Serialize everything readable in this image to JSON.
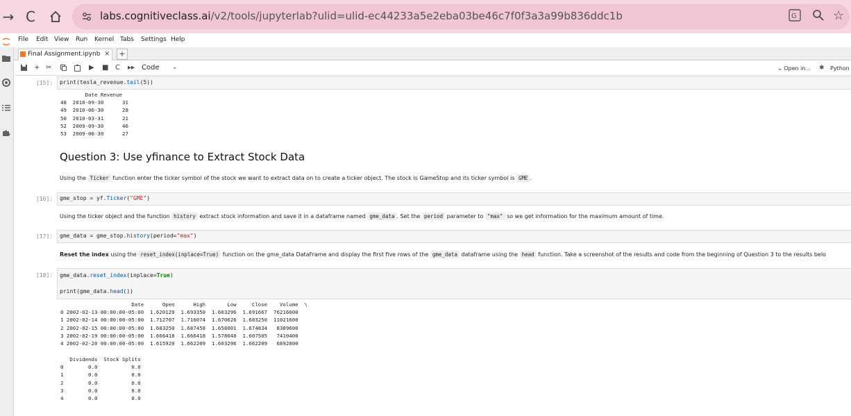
{
  "browser": {
    "url_host": "labs.cognitiveclass.ai",
    "url_path": "/v2/tools/jupyterlab?ulid=ulid-ec44233a5e2eba03be46c7f0f3a3a99b836ddc1b"
  },
  "menu": [
    "File",
    "Edit",
    "View",
    "Run",
    "Kernel",
    "Tabs",
    "Settings",
    "Help"
  ],
  "tab": {
    "title": "Final Assignment.ipynb",
    "close": "×",
    "add": "+"
  },
  "toolbar": {
    "cell_type": "Code",
    "open_in": "Open in...",
    "kernel": "Python"
  },
  "cells": {
    "c15": {
      "prompt": "[15]:",
      "code_obj": "print(tesla_revenue.",
      "code_fn": "tail",
      "code_end": "(5))",
      "output": "        Date Revenue\n48  2010-09-30      31\n49  2010-06-30      28\n50  2010-03-31      21\n52  2009-09-30      46\n53  2009-06-30      27"
    },
    "q3_heading": "Question 3: Use yfinance to Extract Stock Data",
    "md1": {
      "a": "Using the",
      "code1": "Ticker",
      "b": "function enter the ticker symbol of the stock we want to extract data on to create a ticker object. The stock is GameStop and its ticker symbol is",
      "code2": "GME",
      "c": "."
    },
    "c16": {
      "prompt": "[16]:",
      "code_a": "gme_stop = yf.",
      "code_fn": "Ticker",
      "code_b": "(",
      "code_str": "\"GME\"",
      "code_c": ")"
    },
    "md2": {
      "a": "Using the ticker object and the function",
      "code1": "history",
      "b": "extract stock information and save it in a dataframe named",
      "code2": "gme_data",
      "c": ". Set the",
      "code3": "period",
      "d": "parameter to",
      "code4": "\"max\"",
      "e": "so we get information for the maximum amount of time."
    },
    "c17": {
      "prompt": "[17]:",
      "code_a": "gme_data = gme_stop.",
      "code_fn": "history",
      "code_b": "(period=",
      "code_str": "\"max\"",
      "code_c": ")"
    },
    "md3": {
      "bold": "Reset the index",
      "a": "using the",
      "code1": "reset_index(inplace=True)",
      "b": "function on the gme_data DataFrame and display the first five rows of the",
      "code2": "gme_data",
      "c": "dataframe using the",
      "code3": "head",
      "d": "function. Take a screenshot of the results and code from the beginning of Question 3 to the results belo"
    },
    "c18": {
      "prompt": "[18]:",
      "line1_a": "gme_data.",
      "line1_fn": "reset_index",
      "line1_b": "(inplace=",
      "line1_kw": "True",
      "line1_c": ")",
      "line2_a": "print(gme_data.",
      "line2_fn": "head",
      "line2_b": "())",
      "output1": "                       Date      Open      High       Low     Close    Volume  \\\n0 2002-02-13 00:00:00-05:00  1.620129  1.693350  1.603296  1.691667  76216000\n1 2002-02-14 00:00:00-05:00  1.712707  1.716074  1.670626  1.683250  11021600\n2 2002-02-15 00:00:00-05:00  1.683250  1.687458  1.658001  1.674834   8389600\n3 2002-02-19 00:00:00-05:00  1.666418  1.666418  1.578048  1.607505   7410400\n4 2002-02-20 00:00:00-05:00  1.615920  1.662209  1.603296  1.662209   6892800",
      "output2": "   Dividends  Stock Splits\n0        0.0           0.0\n1        0.0           0.0\n2        0.0           0.0\n3        0.0           0.0\n4        0.0           0.0"
    }
  }
}
